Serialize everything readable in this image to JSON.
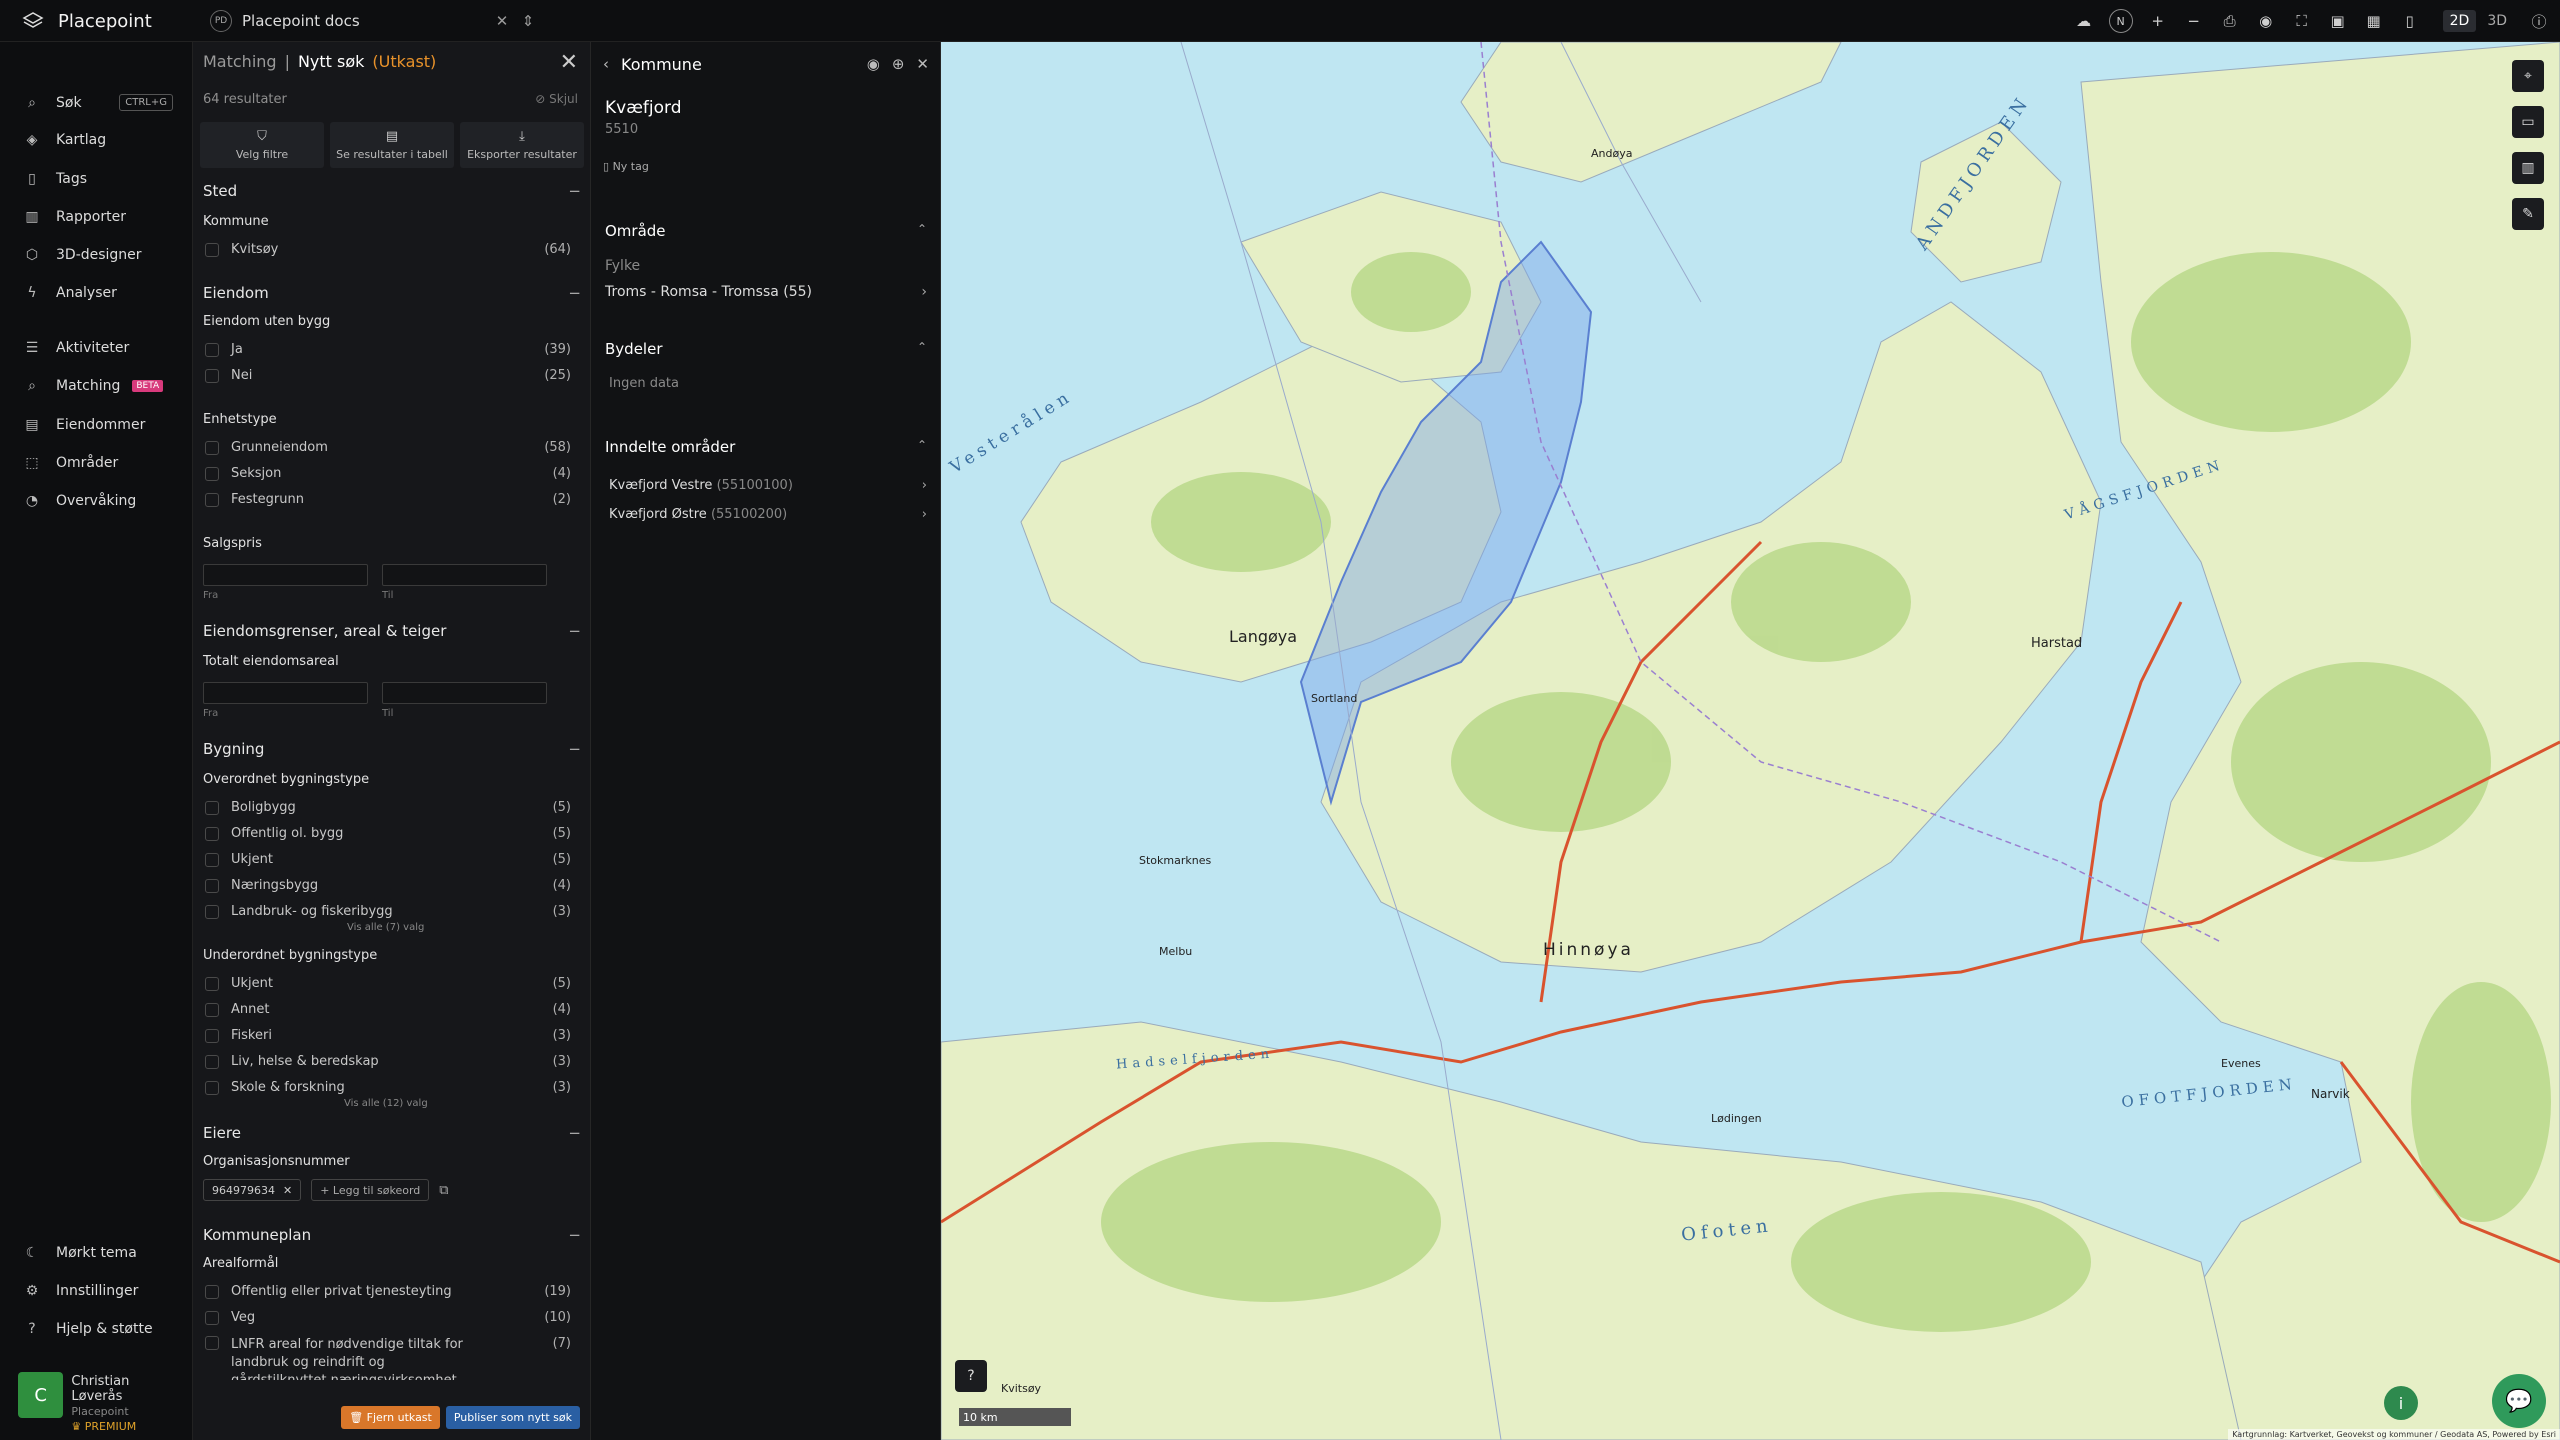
{
  "app": {
    "name": "Placepoint",
    "workspace_badge": "PD",
    "workspace": "Placepoint docs"
  },
  "toolbar": {
    "mode_2d": "2D",
    "mode_3d": "3D",
    "north": "N"
  },
  "nav": {
    "search": "Søk",
    "search_shortcut": "CTRL+G",
    "items": [
      "Kartlag",
      "Tags",
      "Rapporter",
      "3D-designer",
      "Analyser"
    ],
    "items2": [
      "Aktiviteter",
      "Matching",
      "Eiendommer",
      "Områder",
      "Overvåking"
    ],
    "beta": "BETA",
    "bottom": [
      "Mørkt tema",
      "Innstillinger",
      "Hjelp & støtte"
    ],
    "user": {
      "initial": "C",
      "name": "Christian Løverås",
      "org": "Placepoint",
      "tier": "PREMIUM"
    }
  },
  "filters": {
    "breadcrumb": "Matching",
    "title": "Nytt søk",
    "status": "(Utkast)",
    "results": "64 resultater",
    "hide": "Skjul",
    "actions": [
      "Velg filtre",
      "Se resultater i tabell",
      "Eksporter resultater"
    ],
    "sted": {
      "title": "Sted",
      "kommune": "Kommune",
      "opts": [
        {
          "label": "Kvitsøy",
          "count": "(64)"
        }
      ]
    },
    "eiendom": {
      "title": "Eiendom",
      "uten_bygg": "Eiendom uten bygg",
      "uten_opts": [
        {
          "label": "Ja",
          "count": "(39)"
        },
        {
          "label": "Nei",
          "count": "(25)"
        }
      ],
      "enhetstype": "Enhetstype",
      "enhet_opts": [
        {
          "label": "Grunneiendom",
          "count": "(58)"
        },
        {
          "label": "Seksjon",
          "count": "(4)"
        },
        {
          "label": "Festegrunn",
          "count": "(2)"
        }
      ],
      "salgspris": "Salgspris",
      "fra": "Fra",
      "til": "Til"
    },
    "grenser": {
      "title": "Eiendomsgrenser, areal & teiger",
      "areal": "Totalt eiendomsareal",
      "fra": "Fra",
      "til": "Til"
    },
    "bygning": {
      "title": "Bygning",
      "overordnet": "Overordnet bygningstype",
      "over_opts": [
        {
          "label": "Boligbygg",
          "count": "(5)"
        },
        {
          "label": "Offentlig ol. bygg",
          "count": "(5)"
        },
        {
          "label": "Ukjent",
          "count": "(5)"
        },
        {
          "label": "Næringsbygg",
          "count": "(4)"
        },
        {
          "label": "Landbruk- og fiskeribygg",
          "count": "(3)"
        }
      ],
      "over_more": "Vis alle (7) valg",
      "underordnet": "Underordnet bygningstype",
      "under_opts": [
        {
          "label": "Ukjent",
          "count": "(5)"
        },
        {
          "label": "Annet",
          "count": "(4)"
        },
        {
          "label": "Fiskeri",
          "count": "(3)"
        },
        {
          "label": "Liv, helse & beredskap",
          "count": "(3)"
        },
        {
          "label": "Skole & forskning",
          "count": "(3)"
        }
      ],
      "under_more": "Vis alle (12) valg"
    },
    "eiere": {
      "title": "Eiere",
      "org": "Organisasjonsnummer",
      "chip": "964979634",
      "add": "+ Legg til søkeord"
    },
    "kommuneplan": {
      "title": "Kommuneplan",
      "areal": "Arealformål",
      "opts": [
        {
          "label": "Offentlig eller privat tjenesteyting",
          "count": "(19)"
        },
        {
          "label": "Veg",
          "count": "(10)"
        }
      ],
      "lnfr": "LNFR areal for nødvendige tiltak for landbruk og reindrift og gårdstilknyttet næringsvirksomhet",
      "lnfr_count": "(7)"
    },
    "remove_draft": "Fjern utkast",
    "publish": "Publiser som nytt søk"
  },
  "detail": {
    "header": "Kommune",
    "name": "Kvæfjord",
    "code": "5510",
    "new_tag": "Ny tag",
    "omrade": "Område",
    "fylke_label": "Fylke",
    "fylke": "Troms - Romsa - Tromssa (55)",
    "bydeler": "Bydeler",
    "ingen": "Ingen data",
    "inndelte": "Inndelte områder",
    "areas": [
      {
        "name": "Kvæfjord Vestre",
        "id": "(55100100)"
      },
      {
        "name": "Kvæfjord Østre",
        "id": "(55100200)"
      }
    ]
  },
  "map": {
    "water": [
      "ANDFJORDEN",
      "Vesterålen",
      "VÅGSFJORDEN",
      "OFOTFJORDEN",
      "Ofoten",
      "Hadselfjorden"
    ],
    "places": [
      "Langøya",
      "Hinnøya",
      "Harstad",
      "Narvik",
      "Andøya",
      "Sortland",
      "Melbu",
      "Lødingen",
      "Stokmarknes",
      "Evenes",
      "Kvitsøy"
    ],
    "scale": "10 km",
    "attribution": "Kartgrunnlag: Kartverket, Geovekst og kommuner / Geodata AS, Powered by Esri",
    "colors": {
      "water": "#bfe6f2",
      "land": "#e6efc6",
      "forest": "#b9d88a",
      "selection": "#7da7e8"
    }
  }
}
